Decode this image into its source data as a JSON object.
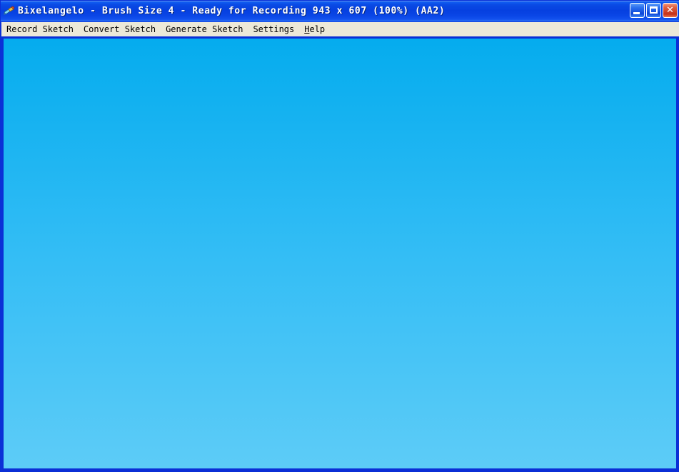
{
  "window": {
    "title": "Bixelangelo - Brush Size 4 - Ready for Recording  943 x 607 (100%) (AA2)",
    "app_name": "Bixelangelo",
    "brush_size_label": "Brush Size 4",
    "status": "Ready for Recording",
    "dimensions": "943 x 607",
    "zoom": "(100%)",
    "antialias": "(AA2)",
    "icon": "brush-icon",
    "buttons": {
      "minimize": "minimize-button",
      "maximize": "maximize-button",
      "close": "close-button",
      "close_glyph": "✕"
    }
  },
  "menu": {
    "items": [
      {
        "label": "Record Sketch",
        "accel": ""
      },
      {
        "label": "Convert Sketch",
        "accel": ""
      },
      {
        "label": "Generate Sketch",
        "accel": ""
      },
      {
        "label": "Settings",
        "accel": ""
      },
      {
        "label": "elp",
        "accel": "H"
      }
    ]
  },
  "canvas": {
    "name": "sketch-canvas",
    "gradient_top": "#05ACEE",
    "gradient_mid": "#33BDF5",
    "gradient_bottom": "#5DCCF7",
    "width_px": "943",
    "height_px": "607"
  },
  "colors": {
    "title_bar_blue": "#0640E0",
    "menu_bar_beige": "#ECE9D8",
    "frame_blue": "#0B2FD6",
    "close_red": "#C5311A"
  }
}
